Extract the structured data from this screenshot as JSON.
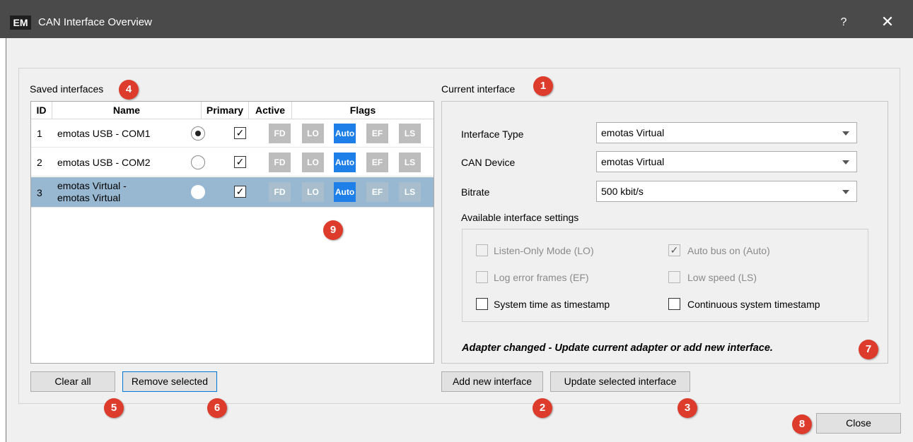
{
  "window": {
    "title": "CAN Interface Overview",
    "help": "?",
    "close": "✕",
    "app_icon": "EM"
  },
  "saved": {
    "heading": "Saved interfaces",
    "columns": [
      "ID",
      "Name",
      "Primary",
      "Active",
      "Flags"
    ],
    "rows": [
      {
        "id": "1",
        "name": "emotas USB - COM1",
        "primary": true,
        "active": "✓",
        "flags": [
          "FD",
          "LO",
          "Auto",
          "EF",
          "LS"
        ],
        "selected": false
      },
      {
        "id": "2",
        "name": "emotas USB - COM2",
        "primary": false,
        "active": "✓",
        "flags": [
          "FD",
          "LO",
          "Auto",
          "EF",
          "LS"
        ],
        "selected": false
      },
      {
        "id": "3",
        "name_line1": "emotas Virtual -",
        "name_line2": "emotas Virtual",
        "primary": false,
        "active": "✓",
        "flags": [
          "FD",
          "LO",
          "Auto",
          "EF",
          "LS"
        ],
        "selected": true
      }
    ],
    "active_flag": "Auto",
    "clear_label": "Clear all",
    "remove_label": "Remove selected"
  },
  "current": {
    "heading": "Current interface",
    "interface_type_label": "Interface Type",
    "interface_type_value": "emotas Virtual",
    "can_device_label": "CAN Device",
    "can_device_value": "emotas Virtual",
    "bitrate_label": "Bitrate",
    "bitrate_value": "500 kbit/s",
    "available_heading": "Available interface settings",
    "settings": {
      "listen_only": "Listen-Only Mode (LO)",
      "auto_bus": "Auto bus on (Auto)",
      "log_error": "Log error frames (EF)",
      "low_speed": "Low speed (LS)",
      "system_time": "System time as timestamp",
      "continuous": "Continuous system timestamp"
    },
    "auto_bus_check": "✓",
    "warning": "Adapter changed - Update current adapter or add new interface.",
    "add_label": "Add new interface",
    "update_label": "Update selected interface"
  },
  "footer": {
    "close_label": "Close"
  },
  "badges": [
    "1",
    "2",
    "3",
    "4",
    "5",
    "6",
    "7",
    "8",
    "9"
  ],
  "colors": {
    "badge": "#dd3b2b",
    "flag_on": "#1e7fe8",
    "flag_off": "#bdbdbd",
    "selected_row": "#97b8d0",
    "titlebar": "#4a4a4a"
  }
}
